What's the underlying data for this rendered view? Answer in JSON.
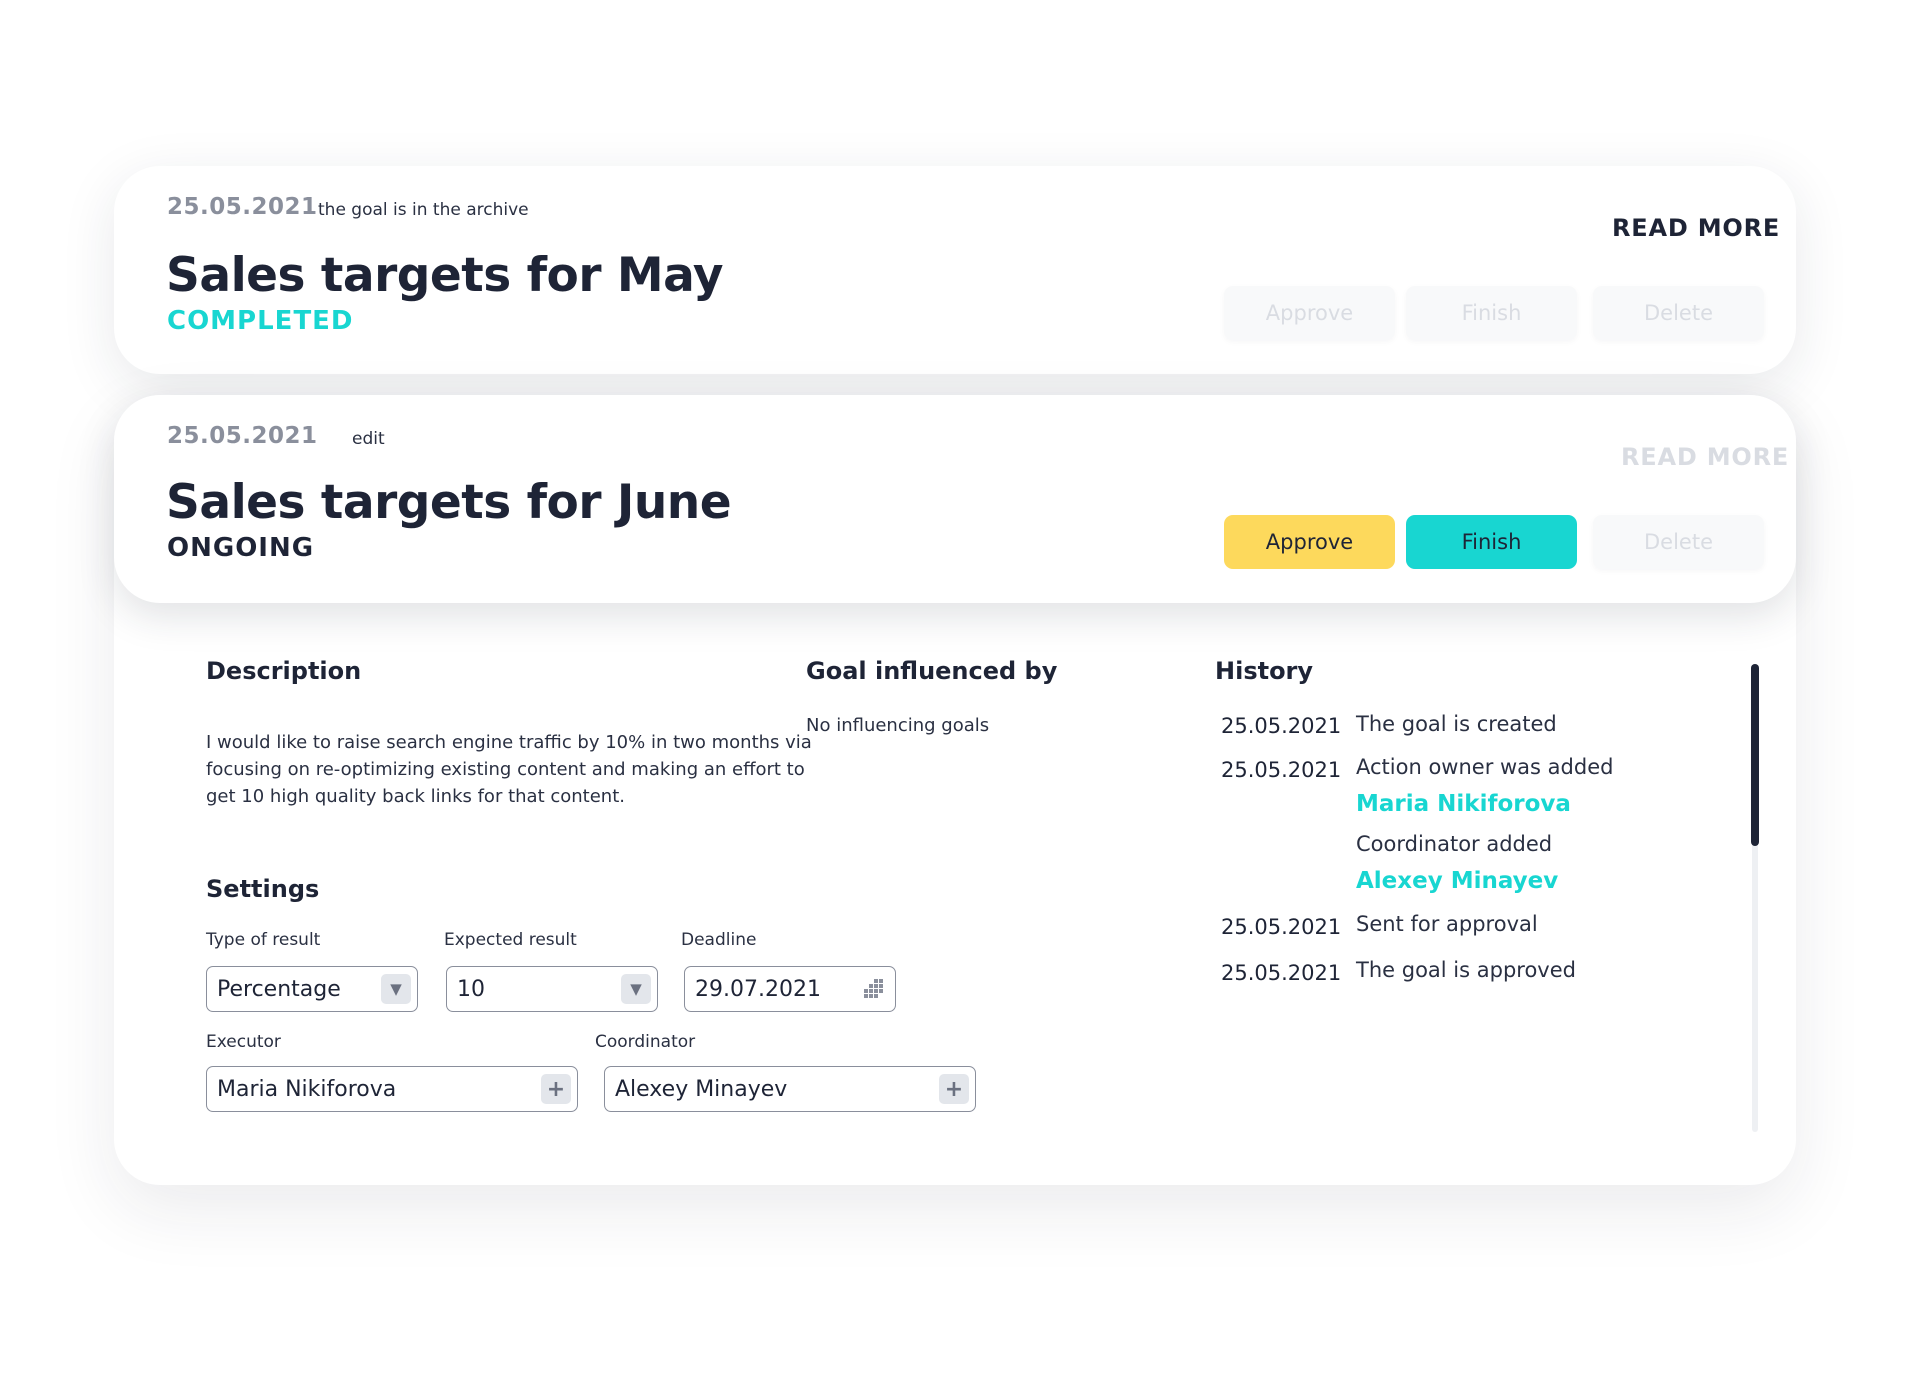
{
  "goals": [
    {
      "date": "25.05.2021",
      "note": "the goal is in the archive",
      "title": "Sales targets for May",
      "status": "COMPLETED",
      "status_color": "#18d6d1",
      "read_more": "READ MORE",
      "actions": {
        "approve": "Approve",
        "finish": "Finish",
        "delete": "Delete"
      }
    },
    {
      "date": "25.05.2021",
      "note": "edit",
      "title": "Sales targets for June",
      "status": "ONGOING",
      "status_color": "#1e2436",
      "read_more": "READ MORE",
      "actions": {
        "approve": "Approve",
        "finish": "Finish",
        "delete": "Delete"
      }
    }
  ],
  "details": {
    "description_title": "Description",
    "description_lines": [
      "I would like to raise search engine traffic by 10% in two months via",
      "focusing on re-optimizing existing content and making an effort to",
      "get 10 high quality back links for that content."
    ],
    "influenced_title": "Goal influenced by",
    "influenced_text": "No influencing goals",
    "settings_title": "Settings",
    "settings": {
      "type_label": "Type of result",
      "type_value": "Percentage",
      "expected_label": "Expected result",
      "expected_value": "10",
      "deadline_label": "Deadline",
      "deadline_value": "29.07.2021",
      "executor_label": "Executor",
      "executor_value": "Maria Nikiforova",
      "coordinator_label": "Coordinator",
      "coordinator_value": "Alexey Minayev"
    },
    "history_title": "History",
    "history": [
      {
        "date": "25.05.2021",
        "text": "The goal is created"
      },
      {
        "date": "25.05.2021",
        "text": "Action owner was added",
        "name": "Maria Nikiforova",
        "text2": "Coordinator added",
        "name2": "Alexey Minayev"
      },
      {
        "date": "25.05.2021",
        "text": "Sent for approval"
      },
      {
        "date": "25.05.2021",
        "text": "The goal is approved"
      }
    ]
  },
  "colors": {
    "accent_teal": "#18d6d1",
    "accent_yellow": "#fdd95c",
    "text_dark": "#1e2436",
    "text_muted": "#8a8f9c"
  }
}
